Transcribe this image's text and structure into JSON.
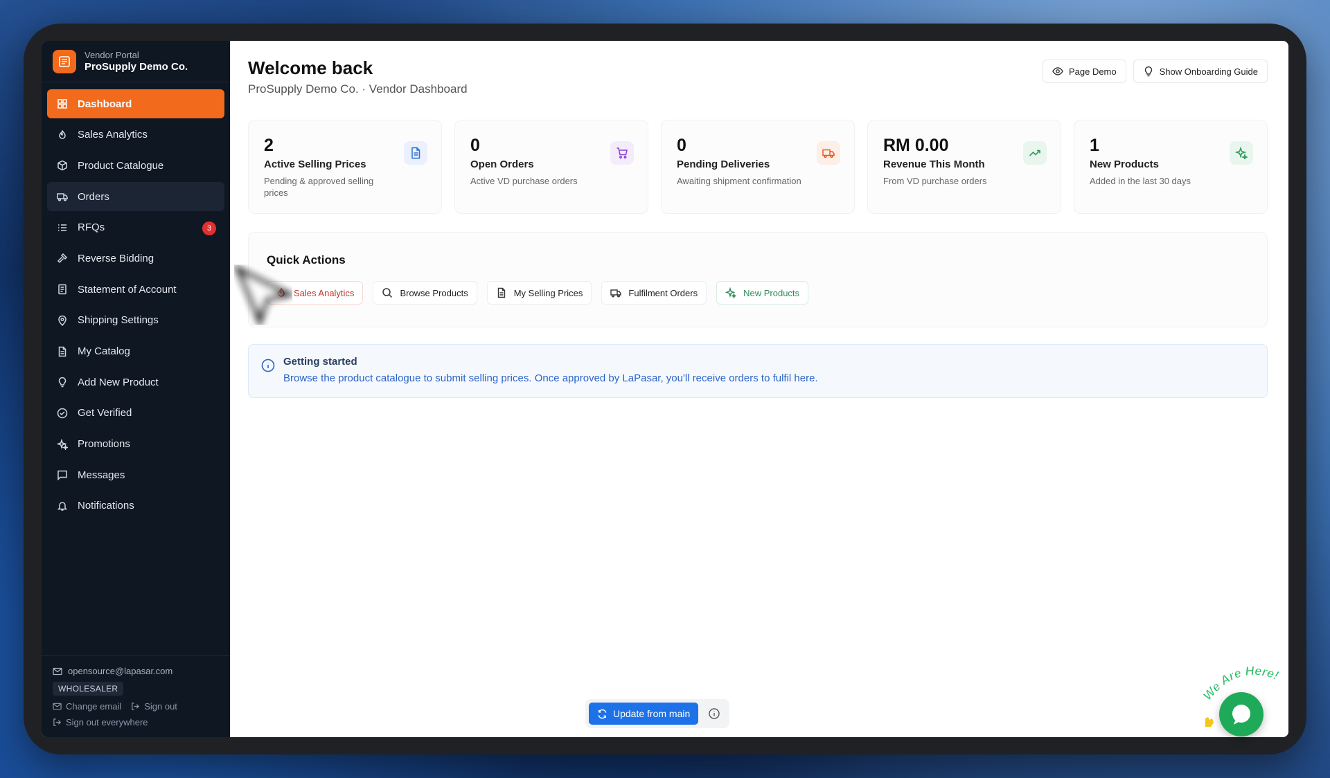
{
  "brand": {
    "subtitle": "Vendor Portal",
    "name": "ProSupply Demo Co.",
    "accent": "#f26a1b"
  },
  "sidebar": {
    "items": [
      {
        "label": "Dashboard",
        "icon": "grid-icon",
        "active": true
      },
      {
        "label": "Sales Analytics",
        "icon": "flame-icon"
      },
      {
        "label": "Product Catalogue",
        "icon": "box-icon"
      },
      {
        "label": "Orders",
        "icon": "truck-icon"
      },
      {
        "label": "RFQs",
        "icon": "list-icon",
        "badge": "3"
      },
      {
        "label": "Reverse Bidding",
        "icon": "gavel-icon"
      },
      {
        "label": "Statement of Account",
        "icon": "doc-icon"
      },
      {
        "label": "Shipping Settings",
        "icon": "pin-icon"
      },
      {
        "label": "My Catalog",
        "icon": "file-icon"
      },
      {
        "label": "Add New Product",
        "icon": "bulb-icon"
      },
      {
        "label": "Get Verified",
        "icon": "check-circle-icon"
      },
      {
        "label": "Promotions",
        "icon": "sparkle-icon"
      },
      {
        "label": "Messages",
        "icon": "chat-icon"
      },
      {
        "label": "Notifications",
        "icon": "bell-icon"
      }
    ],
    "footer": {
      "email": "opensource@lapasar.com",
      "role": "WHOLESALER",
      "change_email": "Change email",
      "sign_out": "Sign out",
      "sign_out_everywhere": "Sign out everywhere"
    }
  },
  "header": {
    "title": "Welcome back",
    "subtitle": "ProSupply Demo Co. · Vendor Dashboard",
    "page_demo": "Page Demo",
    "onboarding": "Show Onboarding Guide"
  },
  "stats": [
    {
      "value": "2",
      "label": "Active Selling Prices",
      "desc": "Pending & approved selling prices",
      "icon": "document-icon",
      "color": "#2b6fd6"
    },
    {
      "value": "0",
      "label": "Open Orders",
      "desc": "Active VD purchase orders",
      "icon": "cart-icon",
      "color": "#8a3fd1"
    },
    {
      "value": "0",
      "label": "Pending Deliveries",
      "desc": "Awaiting shipment confirmation",
      "icon": "truck-icon",
      "color": "#e8591a"
    },
    {
      "value": "RM 0.00",
      "label": "Revenue This Month",
      "desc": "From VD purchase orders",
      "icon": "trending-up-icon",
      "color": "#2f9a5b"
    },
    {
      "value": "1",
      "label": "New Products",
      "desc": "Added in the last 30 days",
      "icon": "sparkle-icon",
      "color": "#2f9a5b"
    }
  ],
  "quick_actions": {
    "title": "Quick Actions",
    "buttons": [
      "Sales Analytics",
      "Browse Products",
      "My Selling Prices",
      "Fulfilment Orders",
      "New Products"
    ]
  },
  "info": {
    "title": "Getting started",
    "text": "Browse the product catalogue to submit selling prices. Once approved by LaPasar, you'll receive orders to fulfil here."
  },
  "update_bar": {
    "label": "Update from main"
  },
  "chat_widget": {
    "label": "We Are Here!"
  }
}
